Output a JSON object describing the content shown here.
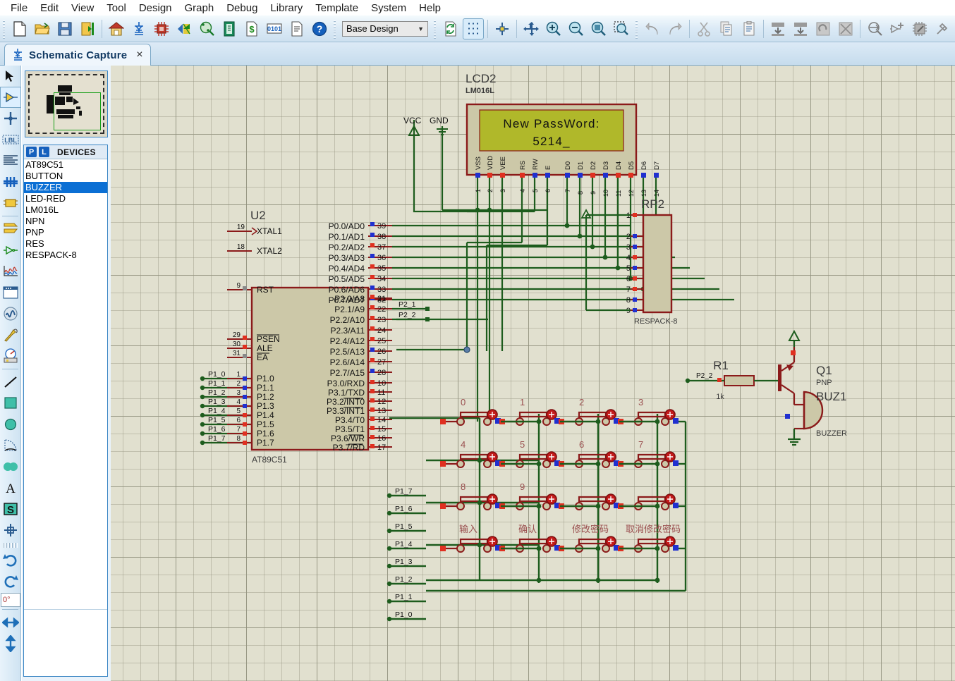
{
  "app": {
    "menu": [
      "File",
      "Edit",
      "View",
      "Tool",
      "Design",
      "Graph",
      "Debug",
      "Library",
      "Template",
      "System",
      "Help"
    ],
    "design_select": "Base Design",
    "design_caret": "⌄",
    "tab": {
      "label": "Schematic Capture",
      "close": "×"
    },
    "rotation_value": "0°"
  },
  "toolbar": {
    "buttons": [
      {
        "name": "new-design-button",
        "icon": "new-document-icon"
      },
      {
        "name": "open-design-button",
        "icon": "open-folder-icon"
      },
      {
        "name": "save-design-button",
        "icon": "save-disk-icon"
      },
      {
        "name": "import-export-button",
        "icon": "export-door-icon"
      },
      {
        "name": "home-sheet-button",
        "icon": "home-icon"
      },
      {
        "name": "schematic-capture-button",
        "icon": "schematic-icon"
      },
      {
        "name": "pcb-layout-button",
        "icon": "chip-icon"
      },
      {
        "name": "3d-visualizer-button",
        "icon": "3d-view-icon"
      },
      {
        "name": "design-explorer-button",
        "icon": "magnifier-green-icon"
      },
      {
        "name": "source-code-button",
        "icon": "source-code-icon"
      },
      {
        "name": "bill-of-materials-button",
        "icon": "dollar-page-icon"
      },
      {
        "name": "netlist-button",
        "icon": "binary-page-icon"
      },
      {
        "name": "report-button",
        "icon": "report-page-icon"
      },
      {
        "name": "help-button",
        "icon": "help-question-icon"
      },
      {
        "name": "refresh-button",
        "icon": "refresh-page-icon"
      },
      {
        "name": "toggle-grid-button",
        "icon": "grid-dots-icon"
      },
      {
        "name": "toggle-origin-button",
        "icon": "origin-cross-icon"
      },
      {
        "name": "pan-button",
        "icon": "pan-arrows-icon"
      },
      {
        "name": "zoom-in-button",
        "icon": "zoom-in-icon"
      },
      {
        "name": "zoom-out-button",
        "icon": "zoom-out-icon"
      },
      {
        "name": "zoom-sheet-button",
        "icon": "zoom-sheet-icon"
      },
      {
        "name": "zoom-area-button",
        "icon": "zoom-area-icon"
      },
      {
        "name": "undo-button",
        "icon": "undo-arrow-icon"
      },
      {
        "name": "redo-button",
        "icon": "redo-arrow-icon"
      },
      {
        "name": "cut-button",
        "icon": "scissors-icon"
      },
      {
        "name": "copy-button",
        "icon": "copy-pages-icon"
      },
      {
        "name": "paste-button",
        "icon": "clipboard-icon"
      },
      {
        "name": "block-copy-button",
        "icon": "block-copy-icon"
      },
      {
        "name": "block-move-button",
        "icon": "block-move-icon"
      },
      {
        "name": "block-rotate-button",
        "icon": "block-rotate-icon"
      },
      {
        "name": "block-delete-button",
        "icon": "block-delete-icon"
      },
      {
        "name": "pick-device-button",
        "icon": "pick-device-icon"
      },
      {
        "name": "make-device-button",
        "icon": "make-device-icon"
      },
      {
        "name": "packaging-tool-button",
        "icon": "packaging-tool-icon"
      },
      {
        "name": "decompose-button",
        "icon": "hammer-icon"
      }
    ]
  },
  "rail": {
    "buttons": [
      {
        "name": "selection-mode-tool",
        "icon": "arrow-cursor-icon"
      },
      {
        "name": "component-mode-tool",
        "icon": "component-icon",
        "selected": true
      },
      {
        "name": "junction-dot-tool",
        "icon": "junction-dot-icon"
      },
      {
        "name": "wire-label-tool",
        "icon": "label-lbl-icon"
      },
      {
        "name": "text-script-tool",
        "icon": "text-script-icon"
      },
      {
        "name": "bus-tool",
        "icon": "bus-icon"
      },
      {
        "name": "subcircuit-tool",
        "icon": "subcircuit-icon"
      },
      {
        "name": "terminals-mode-tool",
        "icon": "terminal-icon"
      },
      {
        "name": "device-pin-tool",
        "icon": "device-pin-icon"
      },
      {
        "name": "graph-mode-tool",
        "icon": "graph-waveform-icon"
      },
      {
        "name": "tape-recorder-tool",
        "icon": "tape-recorder-icon"
      },
      {
        "name": "generator-mode-tool",
        "icon": "generator-sine-icon"
      },
      {
        "name": "voltage-probe-tool",
        "icon": "probe-icon"
      },
      {
        "name": "virtual-instrument-tool",
        "icon": "instrument-meter-icon"
      },
      {
        "name": "line-tool",
        "icon": "line-icon"
      },
      {
        "name": "box-tool",
        "icon": "box-icon"
      },
      {
        "name": "circle-tool",
        "icon": "circle-icon"
      },
      {
        "name": "arc-tool",
        "icon": "arc-icon"
      },
      {
        "name": "path-tool",
        "icon": "path-icon"
      },
      {
        "name": "text-tool",
        "icon": "text-a-icon"
      },
      {
        "name": "symbol-tool",
        "icon": "symbol-s-icon"
      },
      {
        "name": "marker-tool",
        "icon": "marker-cross-icon"
      },
      {
        "name": "rotate-clockwise-button",
        "icon": "rotate-cw-icon"
      },
      {
        "name": "rotate-anticlockwise-button",
        "icon": "rotate-ccw-icon"
      },
      {
        "name": "mirror-horizontal-button",
        "icon": "mirror-horizontal-icon"
      },
      {
        "name": "mirror-vertical-button",
        "icon": "mirror-vertical-icon"
      }
    ]
  },
  "devices": {
    "title": "DEVICES",
    "badge_p": "P",
    "badge_l": "L",
    "items": [
      {
        "label": "AT89C51",
        "selected": false
      },
      {
        "label": "BUTTON",
        "selected": false
      },
      {
        "label": "BUZZER",
        "selected": true
      },
      {
        "label": "LED-RED",
        "selected": false
      },
      {
        "label": "LM016L",
        "selected": false
      },
      {
        "label": "NPN",
        "selected": false
      },
      {
        "label": "PNP",
        "selected": false
      },
      {
        "label": "RES",
        "selected": false
      },
      {
        "label": "RESPACK-8",
        "selected": false
      }
    ]
  },
  "schematic": {
    "lcd": {
      "ref": "LCD2",
      "part": "LM016L",
      "line1": "New PassWord:",
      "line2": "5214_",
      "screen_color": "#b0b82a",
      "body_color": "#ccc8a8",
      "pin_names": [
        "VSS",
        "VDD",
        "VEE",
        "RS",
        "RW",
        "E",
        "D0",
        "D1",
        "D2",
        "D3",
        "D4",
        "D5",
        "D6",
        "D7"
      ],
      "pin_numbers": [
        "1",
        "2",
        "3",
        "4",
        "5",
        "6",
        "7",
        "8",
        "9",
        "10",
        "11",
        "12",
        "13",
        "14"
      ]
    },
    "power": {
      "vcc_label": "VCC",
      "gnd_label": "GND"
    },
    "mcu": {
      "ref": "U2",
      "part": "AT89C51",
      "left_pins": [
        {
          "num": "19",
          "name": "XTAL1"
        },
        {
          "num": "18",
          "name": "XTAL2"
        },
        {
          "num": "9",
          "name": "RST"
        },
        {
          "num": "29",
          "name": "PSEN"
        },
        {
          "num": "30",
          "name": "ALE"
        },
        {
          "num": "31",
          "name": "EA"
        },
        {
          "num": "1",
          "name": "P1.0"
        },
        {
          "num": "2",
          "name": "P1.1"
        },
        {
          "num": "3",
          "name": "P1.2"
        },
        {
          "num": "4",
          "name": "P1.3"
        },
        {
          "num": "5",
          "name": "P1.4"
        },
        {
          "num": "6",
          "name": "P1.5"
        },
        {
          "num": "7",
          "name": "P1.6"
        },
        {
          "num": "8",
          "name": "P1.7"
        }
      ],
      "left_net_labels": [
        "P1_0",
        "P1_1",
        "P1_2",
        "P1_3",
        "P1_4",
        "P1_5",
        "P1_6",
        "P1_7"
      ],
      "right_pins_p0": [
        {
          "num": "39",
          "name": "P0.0/AD0"
        },
        {
          "num": "38",
          "name": "P0.1/AD1"
        },
        {
          "num": "37",
          "name": "P0.2/AD2"
        },
        {
          "num": "36",
          "name": "P0.3/AD3"
        },
        {
          "num": "35",
          "name": "P0.4/AD4"
        },
        {
          "num": "34",
          "name": "P0.5/AD5"
        },
        {
          "num": "33",
          "name": "P0.6/AD6"
        },
        {
          "num": "32",
          "name": "P0.7/AD7"
        }
      ],
      "right_pins_p2": [
        {
          "num": "21",
          "name": "P2.0/A8"
        },
        {
          "num": "22",
          "name": "P2.1/A9"
        },
        {
          "num": "23",
          "name": "P2.2/A10"
        },
        {
          "num": "24",
          "name": "P2.3/A11"
        },
        {
          "num": "25",
          "name": "P2.4/A12"
        },
        {
          "num": "26",
          "name": "P2.5/A13"
        },
        {
          "num": "27",
          "name": "P2.6/A14"
        },
        {
          "num": "28",
          "name": "P2.7/A15"
        }
      ],
      "right_pins_p3": [
        {
          "num": "10",
          "name": "P3.0/RXD"
        },
        {
          "num": "11",
          "name": "P3.1/TXD"
        },
        {
          "num": "12",
          "name": "P3.2/INT0"
        },
        {
          "num": "13",
          "name": "P3.3/INT1"
        },
        {
          "num": "14",
          "name": "P3.4/T0"
        },
        {
          "num": "15",
          "name": "P3.5/T1"
        },
        {
          "num": "16",
          "name": "P3.6/WR"
        },
        {
          "num": "17",
          "name": "P3.7/RD"
        }
      ],
      "p2_net_labels": [
        "P2_1",
        "P2_2"
      ]
    },
    "respack": {
      "ref": "RP2",
      "part": "RESPACK-8",
      "pin_numbers": [
        "1",
        "2",
        "3",
        "4",
        "5",
        "6",
        "7",
        "8",
        "9"
      ]
    },
    "resistor": {
      "ref": "R1",
      "value": "1k",
      "net_label": "P2_2"
    },
    "transistor": {
      "ref": "Q1",
      "part": "PNP"
    },
    "buzzer": {
      "ref": "BUZ1",
      "part": "BUZZER"
    },
    "keypad": {
      "rows": [
        [
          "0",
          "1",
          "2",
          "3"
        ],
        [
          "4",
          "5",
          "6",
          "7"
        ],
        [
          "8",
          "9",
          "",
          ""
        ],
        [
          "输入",
          "确认",
          "修改密码",
          "取消修改密码"
        ]
      ]
    },
    "bus_labels_left": [
      "P1_7",
      "P1_6",
      "P1_5",
      "P1_4",
      "P1_3",
      "P1_2",
      "P1_1",
      "P1_0"
    ],
    "colors": {
      "wire": "#1d5c1d",
      "body_outline": "#8b1a1a",
      "body_fill": "#ccc8a8",
      "pin_label": "#101010",
      "ref_label": "#3a3a3a",
      "grid_bg": "#e1e0cf",
      "key_label": "#9a4f4f"
    }
  }
}
